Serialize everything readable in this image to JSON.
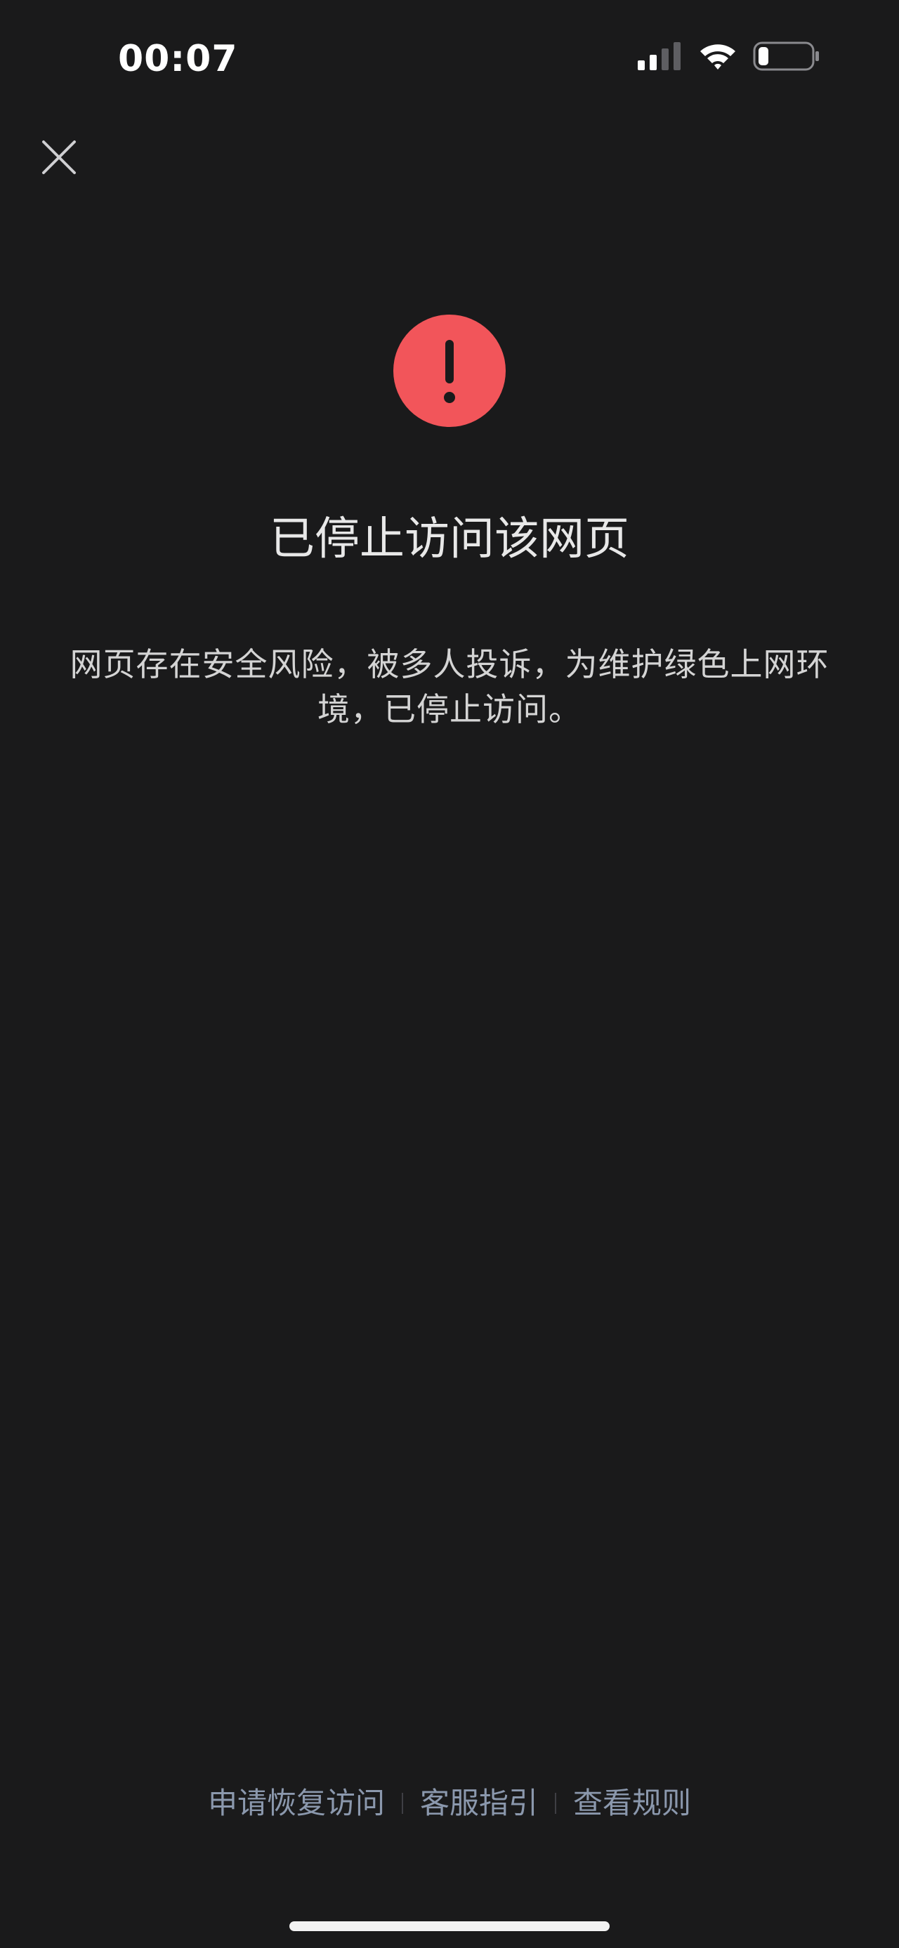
{
  "status_bar": {
    "time": "00:07",
    "signal_icon": "cellular-signal-icon",
    "wifi_icon": "wifi-icon",
    "battery_icon": "battery-low-icon"
  },
  "nav": {
    "close_icon": "close-icon"
  },
  "main": {
    "warning_icon": "exclamation-circle-icon",
    "warning_color": "#f2555a",
    "title": "已停止访问该网页",
    "description": "网页存在安全风险，被多人投诉，为维护绿色上网环境，已停止访问。"
  },
  "footer": {
    "links": [
      "申请恢复访问",
      "客服指引",
      "查看规则"
    ],
    "link_color": "#8b98ad"
  }
}
